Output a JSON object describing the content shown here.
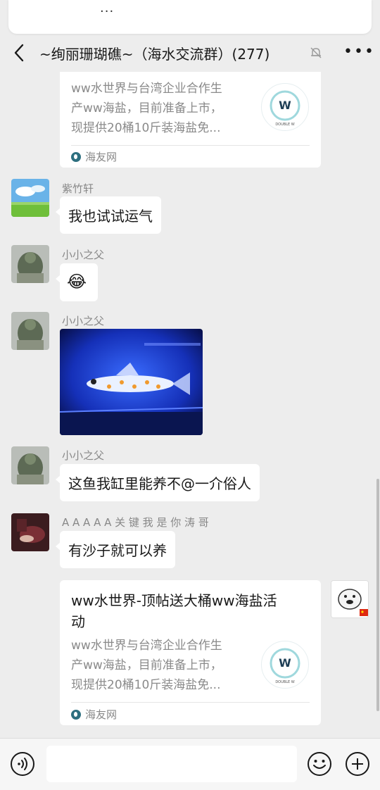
{
  "top_bar": {
    "dots": "···"
  },
  "header": {
    "title": "~绚丽珊瑚礁~（海水交流群）(277)"
  },
  "messages": {
    "card1": {
      "desc_lines": [
        "ww水世界与台湾企业合作生",
        "产ww海盐，目前准备上市，",
        "现提供20桶10斤装海盐免..."
      ],
      "source": "海友网",
      "thumb_text": "DOUBLE W"
    },
    "m1": {
      "sender": "紫竹轩",
      "text": "我也试试运气"
    },
    "m2": {
      "sender": "小小之父",
      "emoji": "😂"
    },
    "m3": {
      "sender": "小小之父"
    },
    "m4": {
      "sender": "小小之父",
      "text": "这鱼我缸里能养不@一介俗人"
    },
    "m5": {
      "sender": "A A A A A 关 键 我 是 你 涛 哥",
      "text": "有沙子就可以养"
    },
    "card2": {
      "title_lines": [
        "ww水世界-顶帖送大桶ww海盐活",
        "动"
      ],
      "desc_lines": [
        "ww水世界与台湾企业合作生",
        "产ww海盐，目前准备上市，",
        "现提供20桶10斤装海盐免..."
      ],
      "source": "海友网",
      "thumb_text": "DOUBLE W"
    }
  },
  "input_bar": {
    "placeholder": ""
  },
  "colors": {
    "background": "#ededed",
    "bubble": "#ffffff",
    "sender_text": "#888888",
    "card_desc": "#8a8a8a"
  }
}
